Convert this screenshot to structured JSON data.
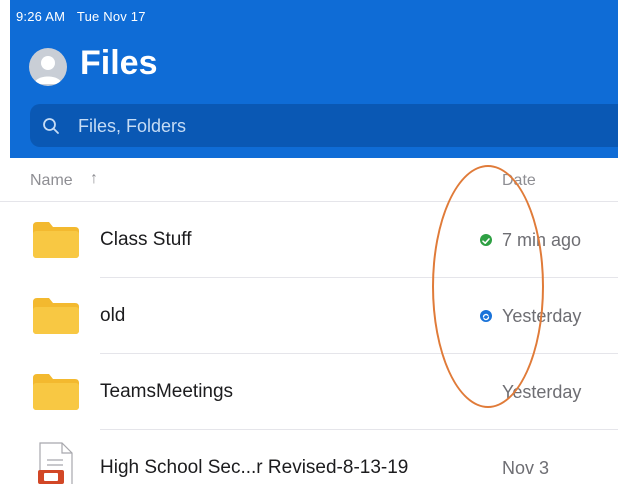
{
  "status_bar": {
    "time": "9:26 AM",
    "date": "Tue Nov 17"
  },
  "header": {
    "title": "Files",
    "avatar_icon": "person-icon",
    "accent_color": "#0f6cd6"
  },
  "search": {
    "placeholder": "Files, Folders",
    "icon": "search-icon"
  },
  "columns": {
    "name": "Name",
    "sort_indicator": "↑",
    "date": "Date"
  },
  "rows": [
    {
      "name": "Class Stuff",
      "type": "folder",
      "sync_status": "synced",
      "date": "7 min ago"
    },
    {
      "name": "old",
      "type": "folder",
      "sync_status": "syncing",
      "date": "Yesterday"
    },
    {
      "name": "TeamsMeetings",
      "type": "folder",
      "sync_status": "",
      "date": "Yesterday"
    },
    {
      "name": "High School Sec...r Revised-8-13-19",
      "type": "powerpoint-file",
      "sync_status": "",
      "date": "Nov 3"
    }
  ],
  "colors": {
    "folder": "#f8c843",
    "synced": "#2ea043",
    "syncing": "#1a73d9",
    "annotation": "#e07b39"
  }
}
